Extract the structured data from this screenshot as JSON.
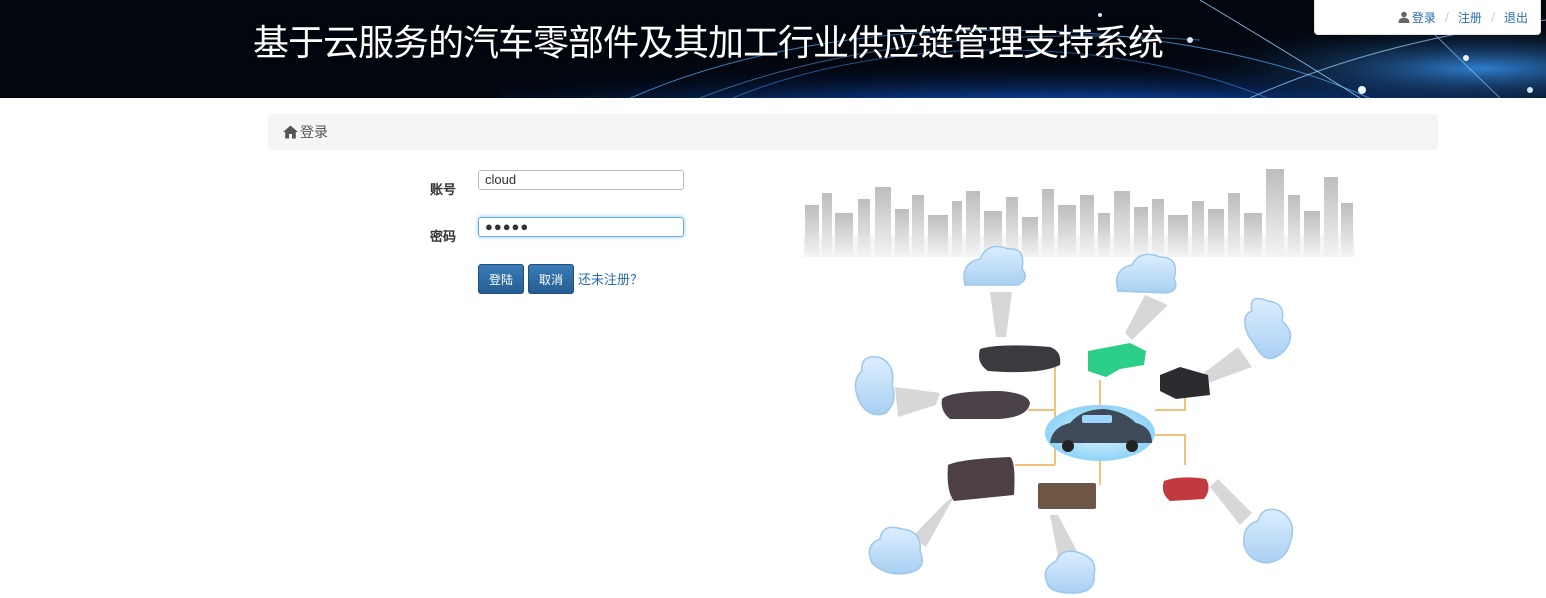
{
  "header": {
    "title": "基于云服务的汽车零部件及其加工行业供应链管理支持系统"
  },
  "topnav": {
    "login": "登录",
    "register": "注册",
    "logout": "退出",
    "separator": "/"
  },
  "breadcrumb": {
    "current": "登录"
  },
  "form": {
    "account_label": "账号",
    "account_value": "cloud",
    "password_label": "密码",
    "password_value": "●●●●●",
    "login_button": "登陆",
    "cancel_button": "取消",
    "register_link": "还未注册？"
  },
  "colors": {
    "link": "#2a6db0",
    "button": "#2d6ca2",
    "banner_bg": "#02060f"
  },
  "icons": {
    "user": "user-icon",
    "home": "home-icon"
  }
}
